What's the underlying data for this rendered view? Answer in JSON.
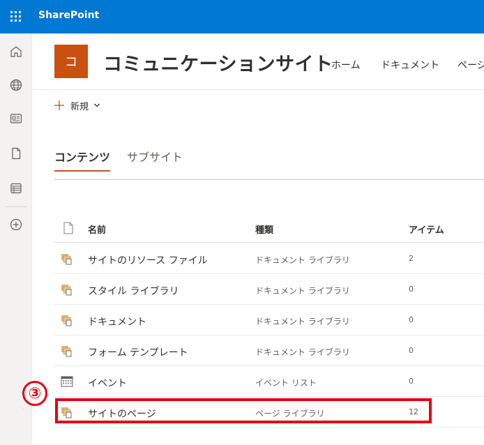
{
  "topbar": {
    "app_name": "SharePoint",
    "color": "#0078d4",
    "waffle_icon": "app-launcher-icon"
  },
  "left_rail": {
    "items": [
      {
        "icon": "home-icon"
      },
      {
        "icon": "globe-icon"
      },
      {
        "icon": "news-icon"
      },
      {
        "icon": "document-icon"
      },
      {
        "icon": "list-icon"
      },
      {
        "icon": "add-circle-icon"
      }
    ]
  },
  "site": {
    "logo_letter": "コ",
    "logo_color": "#ca5010",
    "title": "コミュニケーションサイト",
    "nav": [
      "ホーム",
      "ドキュメント",
      "ページ"
    ]
  },
  "command_bar": {
    "new_label": "新規"
  },
  "tabs": [
    {
      "label": "コンテンツ",
      "active": true
    },
    {
      "label": "サブサイト",
      "active": false
    }
  ],
  "list": {
    "columns": {
      "name": "名前",
      "type": "種類",
      "items": "アイテム"
    },
    "rows": [
      {
        "name": "サイトのリソース ファイル",
        "type": "ドキュメント ライブラリ",
        "count": "2",
        "icon": "library-icon"
      },
      {
        "name": "スタイル ライブラリ",
        "type": "ドキュメント ライブラリ",
        "count": "0",
        "icon": "library-icon"
      },
      {
        "name": "ドキュメント",
        "type": "ドキュメント ライブラリ",
        "count": "0",
        "icon": "library-icon"
      },
      {
        "name": "フォーム テンプレート",
        "type": "ドキュメント ライブラリ",
        "count": "0",
        "icon": "library-icon"
      },
      {
        "name": "イベント",
        "type": "イベント リスト",
        "count": "0",
        "icon": "calendar-icon"
      },
      {
        "name": "サイトのページ",
        "type": "ページ ライブラリ",
        "count": "12",
        "icon": "library-icon"
      }
    ]
  },
  "annotation": {
    "step_label": "③",
    "color": "#e60012"
  }
}
